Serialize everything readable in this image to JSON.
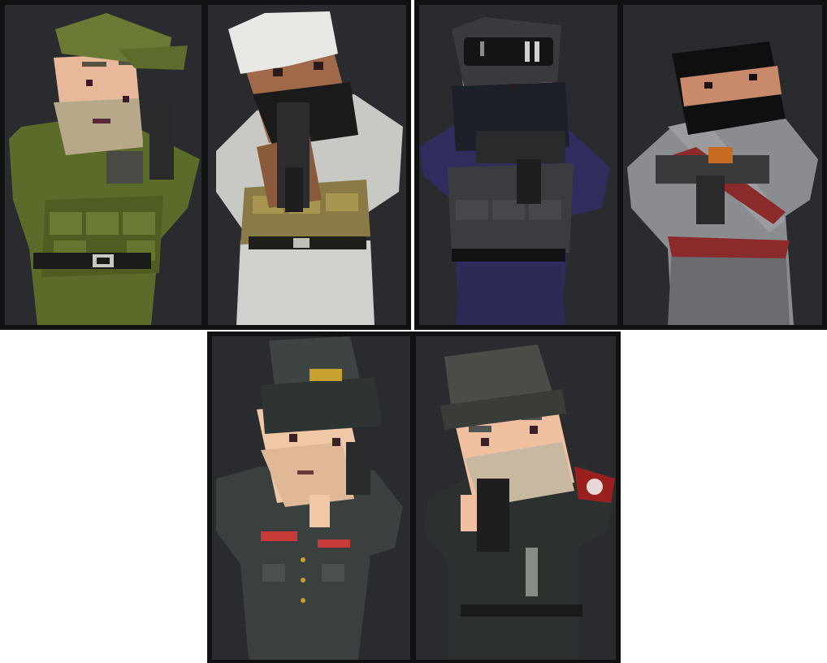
{
  "characters": [
    {
      "id": "green-soldier",
      "palette": {
        "uniform": "#5b6b2a",
        "skin": "#e8b89a",
        "beard": "#b8a88a",
        "hat": "#6a7a35"
      }
    },
    {
      "id": "desert-fighter",
      "palette": {
        "robe": "#c8c8c4",
        "skin": "#a06a4a",
        "beard": "#1a1a1a",
        "vest": "#8a7a45"
      }
    },
    {
      "id": "night-operator",
      "palette": {
        "uniform": "#2e2d5e",
        "skin": "#d8a888",
        "mask": "#1c2028",
        "goggles": "#3a3a3e"
      }
    },
    {
      "id": "masked-gunner",
      "palette": {
        "shirt": "#9a9ca0",
        "skin": "#c88a6a",
        "mask": "#0e1010",
        "ammo": "#8a2a2a"
      }
    },
    {
      "id": "officer",
      "palette": {
        "uniform": "#3a403e",
        "skin": "#f0c8a8",
        "cap": "#3e4442",
        "badge": "#c8a030"
      }
    },
    {
      "id": "armband-soldier",
      "palette": {
        "uniform": "#2c302e",
        "skin": "#f0c0a0",
        "cap": "#4a4c48",
        "armband": "#9a2020"
      }
    }
  ]
}
